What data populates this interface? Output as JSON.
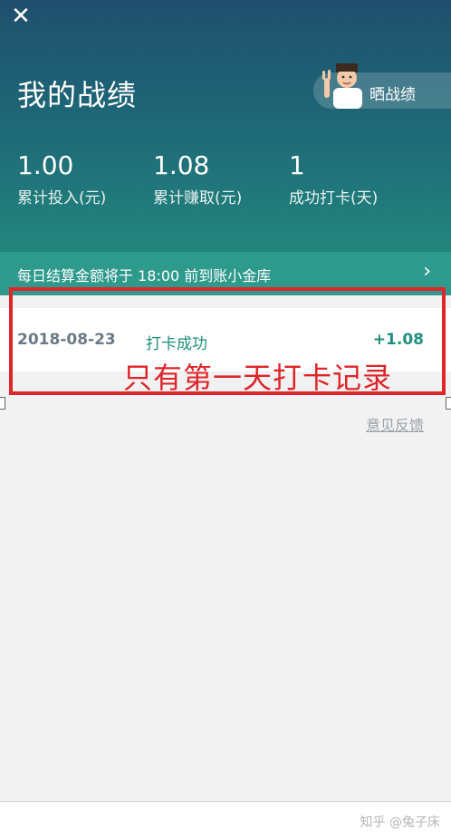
{
  "header": {
    "close_glyph": "✕",
    "title": "我的战绩",
    "share_label": "晒战绩"
  },
  "stats": [
    {
      "value": "1.00",
      "label": "累计投入(元)"
    },
    {
      "value": "1.08",
      "label": "累计赚取(元)"
    },
    {
      "value": "1",
      "label": "成功打卡(天)"
    }
  ],
  "notice": {
    "text": "每日结算金额将于 18:00 前到账小金库",
    "chevron": "›"
  },
  "records": [
    {
      "date": "2018-08-23",
      "status": "打卡成功",
      "amount": "+1.08"
    }
  ],
  "annotation": {
    "text": "只有第一天打卡记录",
    "color": "#e0252a"
  },
  "feedback_label": "意见反馈",
  "watermark": "知乎 @兔子床",
  "colors": {
    "accent": "#1f8f7e",
    "header_top": "#1f4f6d",
    "header_bottom": "#24907e"
  }
}
